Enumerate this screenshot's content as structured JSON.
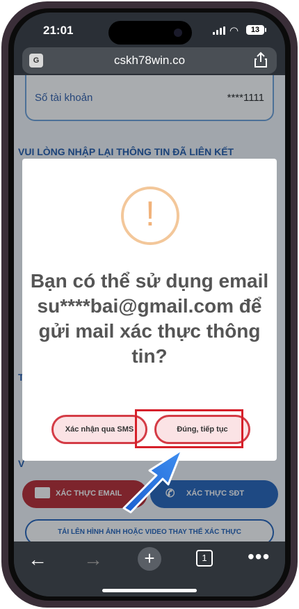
{
  "status": {
    "time": "21:01",
    "battery": "13"
  },
  "browser": {
    "url": "cskh78win.co"
  },
  "page": {
    "account_label": "Số tài khoản",
    "account_value": "****1111",
    "relink_heading": "VUI LÒNG NHẬP LẠI THÔNG TIN ĐÃ LIÊN KẾT",
    "side_char_1": "T",
    "side_char_2": "V",
    "verify_email_label": "XÁC THỰC EMAIL",
    "verify_phone_label": "XÁC THỰC SĐT",
    "upload_label": "TẢI LÊN HÌNH ẢNH HOẶC VIDEO THAY THẾ XÁC THỰC"
  },
  "dialog": {
    "icon": "!",
    "message": "Bạn có thể sử dụng email su****bai@gmail.com để gửi mail xác thực thông tin?",
    "sms_label": "Xác nhận qua SMS",
    "continue_label": "Đúng, tiếp tục"
  },
  "toolbar": {
    "tab_count": "1"
  },
  "colors": {
    "accent_red": "#d43c46",
    "accent_blue": "#1f5fb8",
    "warning": "#f1b27a"
  }
}
